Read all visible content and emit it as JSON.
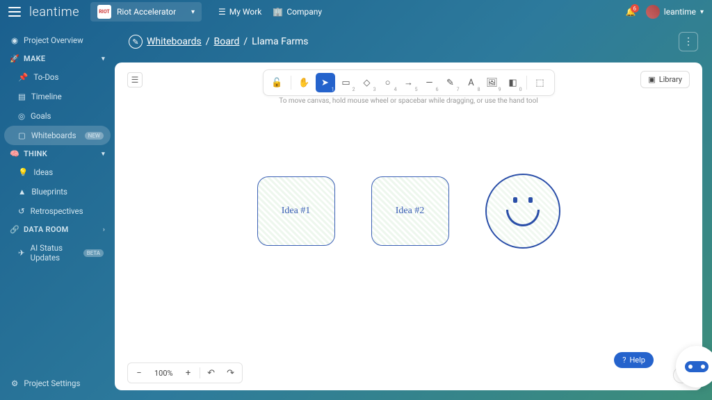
{
  "brand": "leantime",
  "project": {
    "logo_text": "RIOT",
    "name": "Riot Accelerator"
  },
  "topnav": {
    "mywork": "My Work",
    "company": "Company"
  },
  "notifications_count": "6",
  "user_label": "leantime",
  "sidebar": {
    "overview": "Project Overview",
    "sections": {
      "make": "MAKE",
      "think": "THINK",
      "dataroom": "DATA ROOM"
    },
    "items": {
      "todos": "To-Dos",
      "timeline": "Timeline",
      "goals": "Goals",
      "whiteboards": "Whiteboards",
      "whiteboards_badge": "NEW",
      "ideas": "Ideas",
      "blueprints": "Blueprints",
      "retrospectives": "Retrospectives",
      "ai_status": "AI Status Updates",
      "ai_status_badge": "BETA",
      "settings": "Project Settings"
    }
  },
  "breadcrumb": {
    "root": "Whiteboards",
    "mid": "Board",
    "leaf": "Llama Farms"
  },
  "canvas": {
    "hint": "To move canvas, hold mouse wheel or spacebar while dragging, or use the hand tool",
    "library": "Library",
    "shapes": {
      "idea1": "Idea #1",
      "idea2": "Idea #2"
    },
    "zoom": "100%",
    "help": "Help"
  },
  "tool_keys": {
    "lock": "",
    "hand": "",
    "select": "1",
    "rect": "2",
    "diamond": "3",
    "circle": "4",
    "arrow": "5",
    "line": "6",
    "pencil": "7",
    "text": "8",
    "image": "9",
    "eraser": "0",
    "frame": ""
  }
}
